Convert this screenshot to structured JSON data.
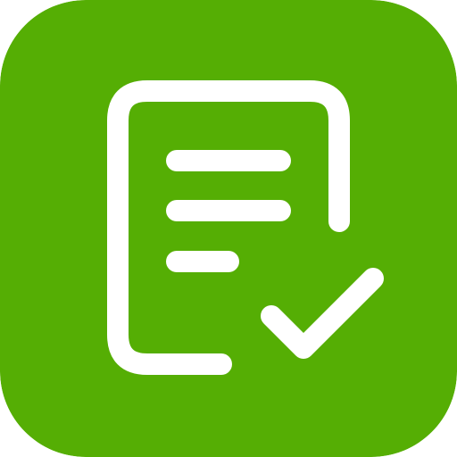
{
  "app_icon": {
    "semantic": "document-checklist-icon",
    "colors": {
      "background": "#55AE04",
      "glyph": "#FFFFFF"
    }
  }
}
